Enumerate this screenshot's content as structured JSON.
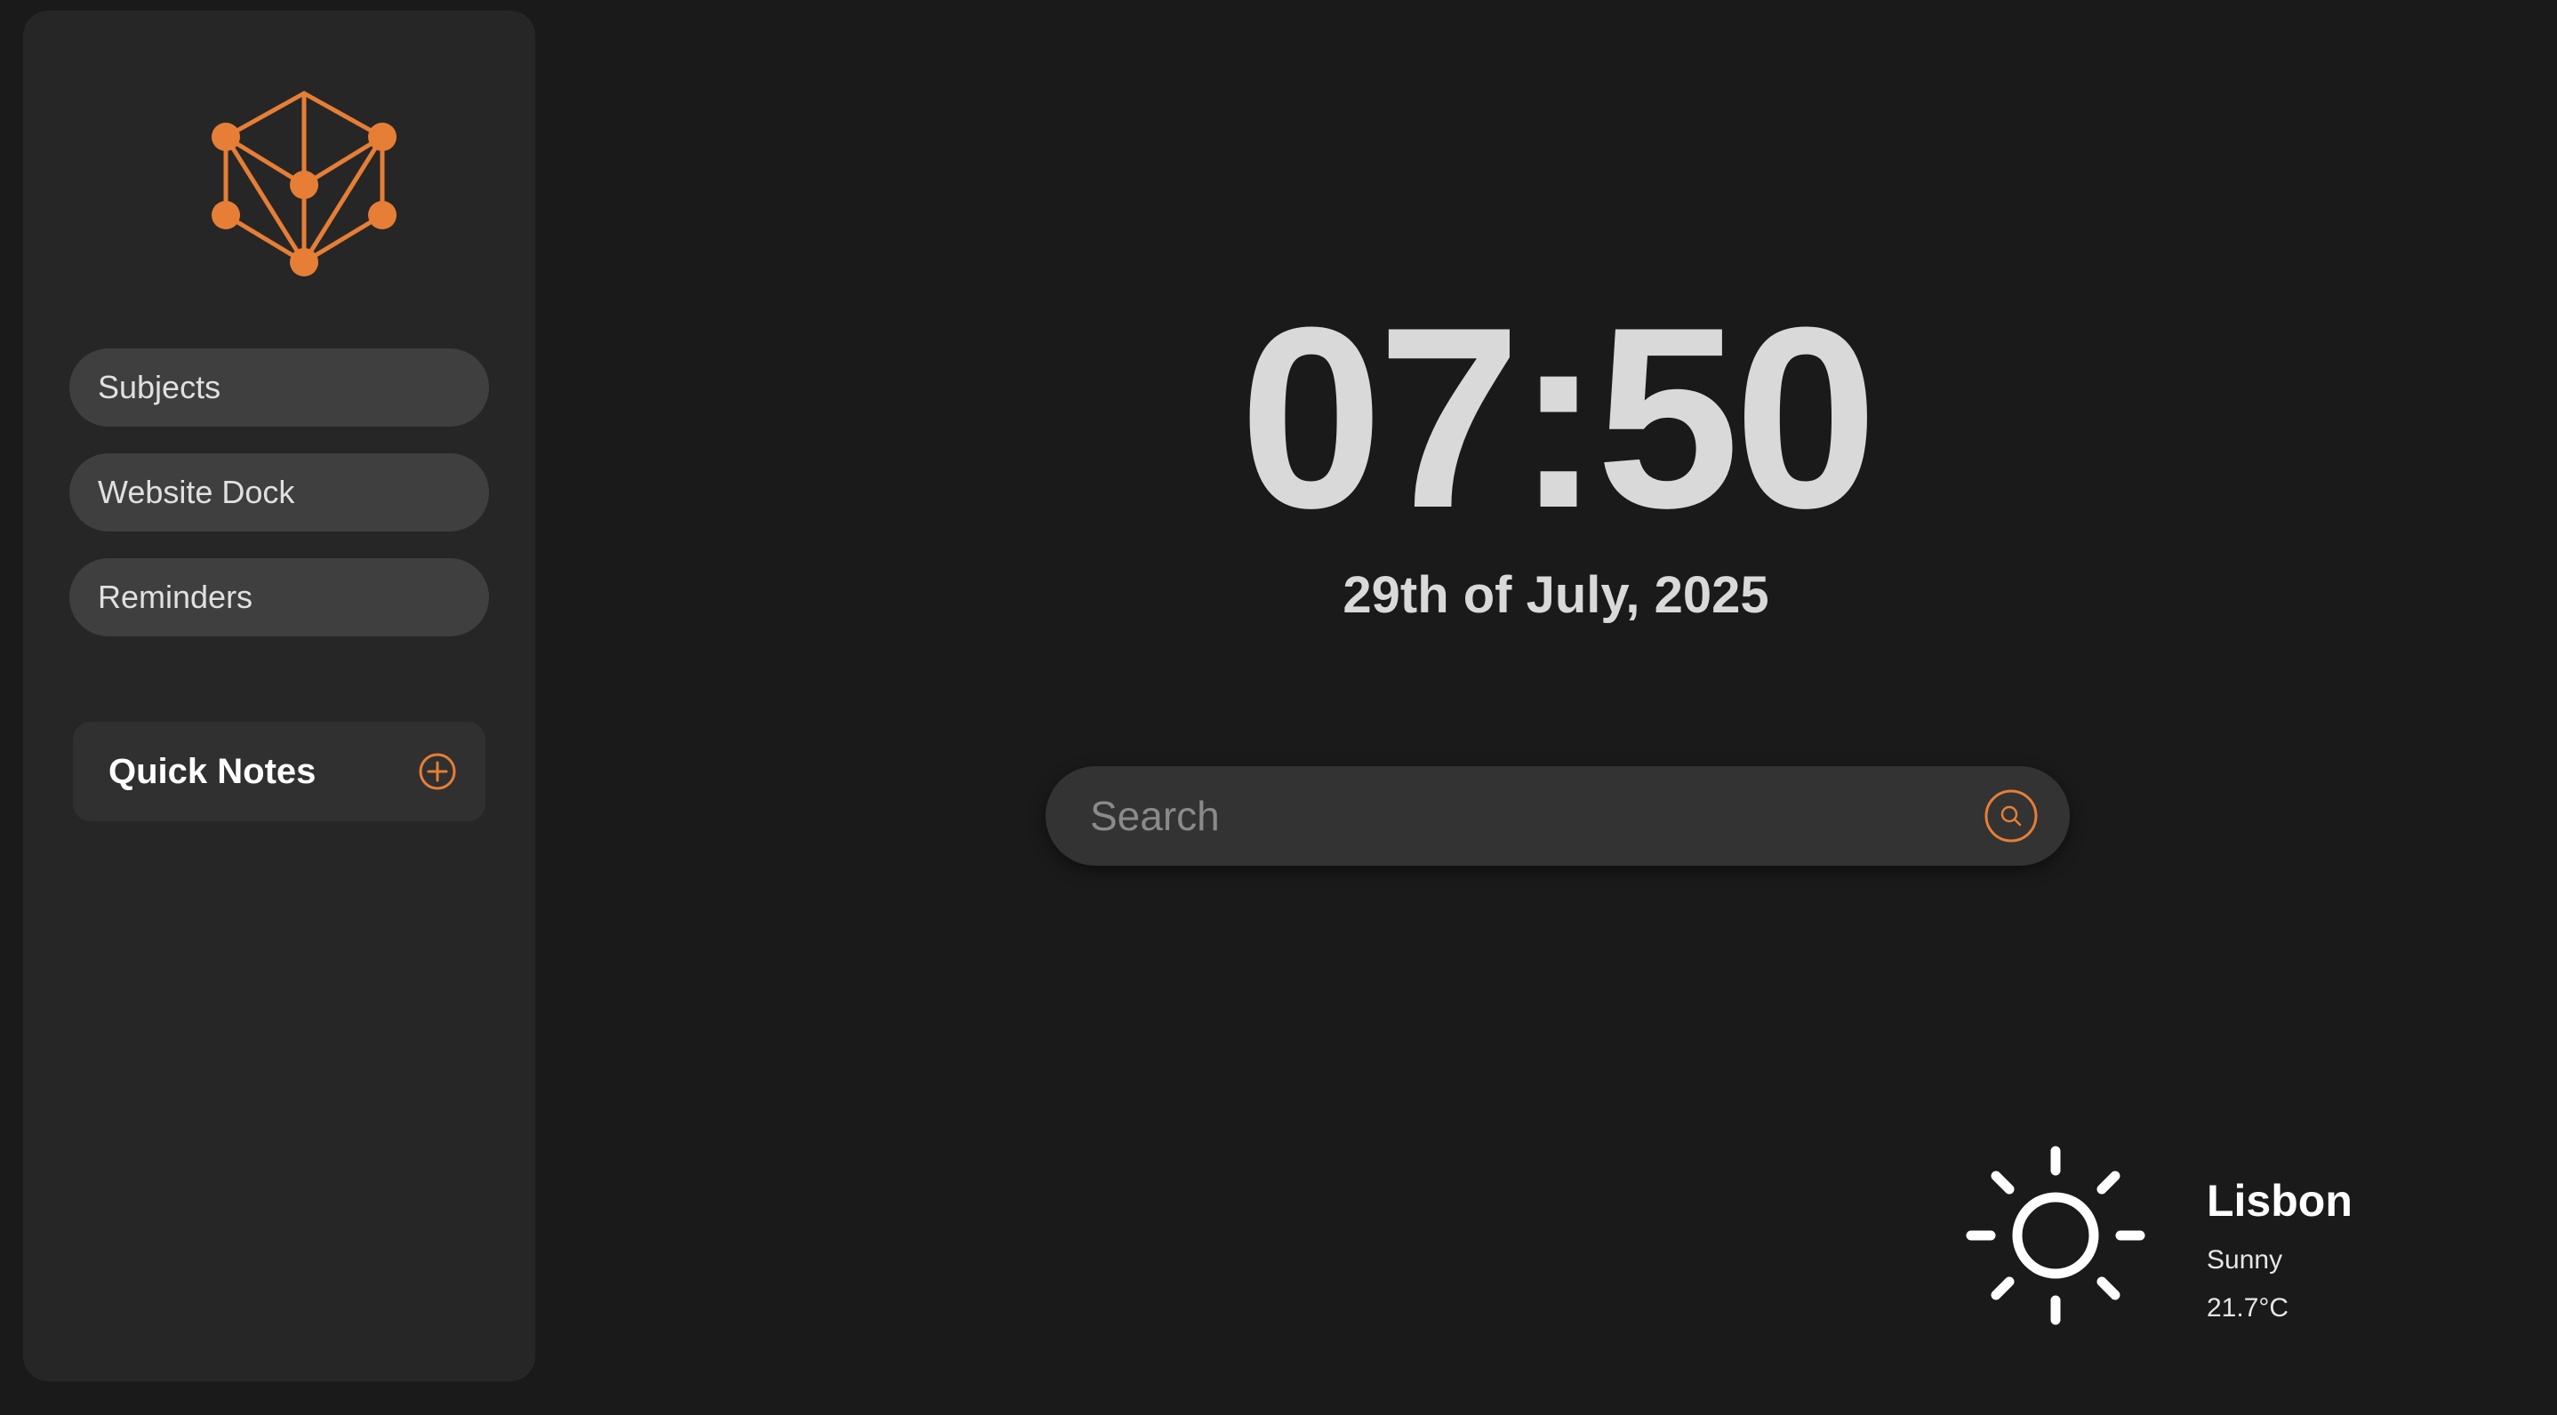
{
  "theme": {
    "background": "#1a1a1a",
    "sidebar_background": "#262626",
    "accent": "#e67e36",
    "text_primary": "#d9d9d9"
  },
  "sidebar": {
    "logo_icon": "network-cube-icon",
    "nav_items": [
      {
        "label": "Subjects"
      },
      {
        "label": "Website Dock"
      },
      {
        "label": "Reminders"
      }
    ],
    "quick_notes": {
      "label": "Quick Notes",
      "add_icon": "plus-circle-icon"
    }
  },
  "main": {
    "time": "07:50",
    "date": "29th of July, 2025",
    "search": {
      "placeholder": "Search",
      "value": "",
      "icon": "search-icon"
    }
  },
  "weather": {
    "icon": "sun-icon",
    "city": "Lisbon",
    "condition": "Sunny",
    "temperature": "21.7°C"
  }
}
